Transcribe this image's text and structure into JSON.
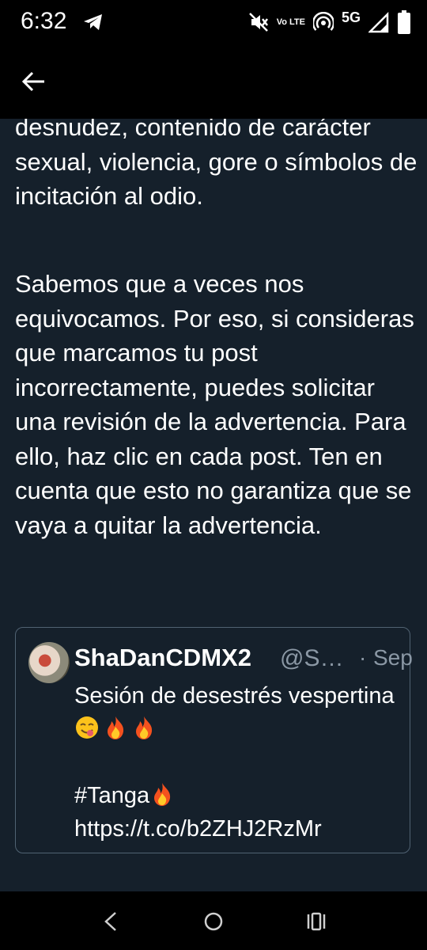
{
  "status_bar": {
    "time": "6:32",
    "network": "5G",
    "volte": "Vo LTE",
    "icons": [
      "telegram-icon",
      "mute-icon",
      "volte-icon",
      "hotspot-icon",
      "signal-icon",
      "battery-icon"
    ]
  },
  "app_bar": {
    "back_icon": "arrow-left-icon"
  },
  "content": {
    "paragraph_1": "desnudez, contenido de carácter sexual, violencia, gore o símbolos de incitación al odio.",
    "paragraph_2": "Sabemos que a veces nos equivocamos. Por eso, si consideras que marcamos tu post incorrectamente, puedes solicitar una revisión de la advertencia. Para ello, haz clic en cada post. Ten en cuenta que esto no garantiza que se vaya a quitar la advertencia."
  },
  "quoted_post": {
    "display_name": "ShaDanCDMX2",
    "handle": "@S…",
    "separator": "·",
    "date": "Sep",
    "text_line_1": "Sesión de desestrés vespertina",
    "emojis": [
      "yum-emoji",
      "fire-emoji",
      "fire-emoji"
    ],
    "hashtag": "#Tanga",
    "hashtag_emoji": "fire-emoji",
    "link": "https://t.co/b2ZHJ2RzMr"
  },
  "nav_bar": {
    "buttons": [
      "back-nav-icon",
      "home-nav-icon",
      "recents-nav-icon"
    ]
  },
  "colors": {
    "background": "#15202b",
    "bars": "#000000",
    "muted_text": "#8b98a5",
    "border": "#506272"
  }
}
